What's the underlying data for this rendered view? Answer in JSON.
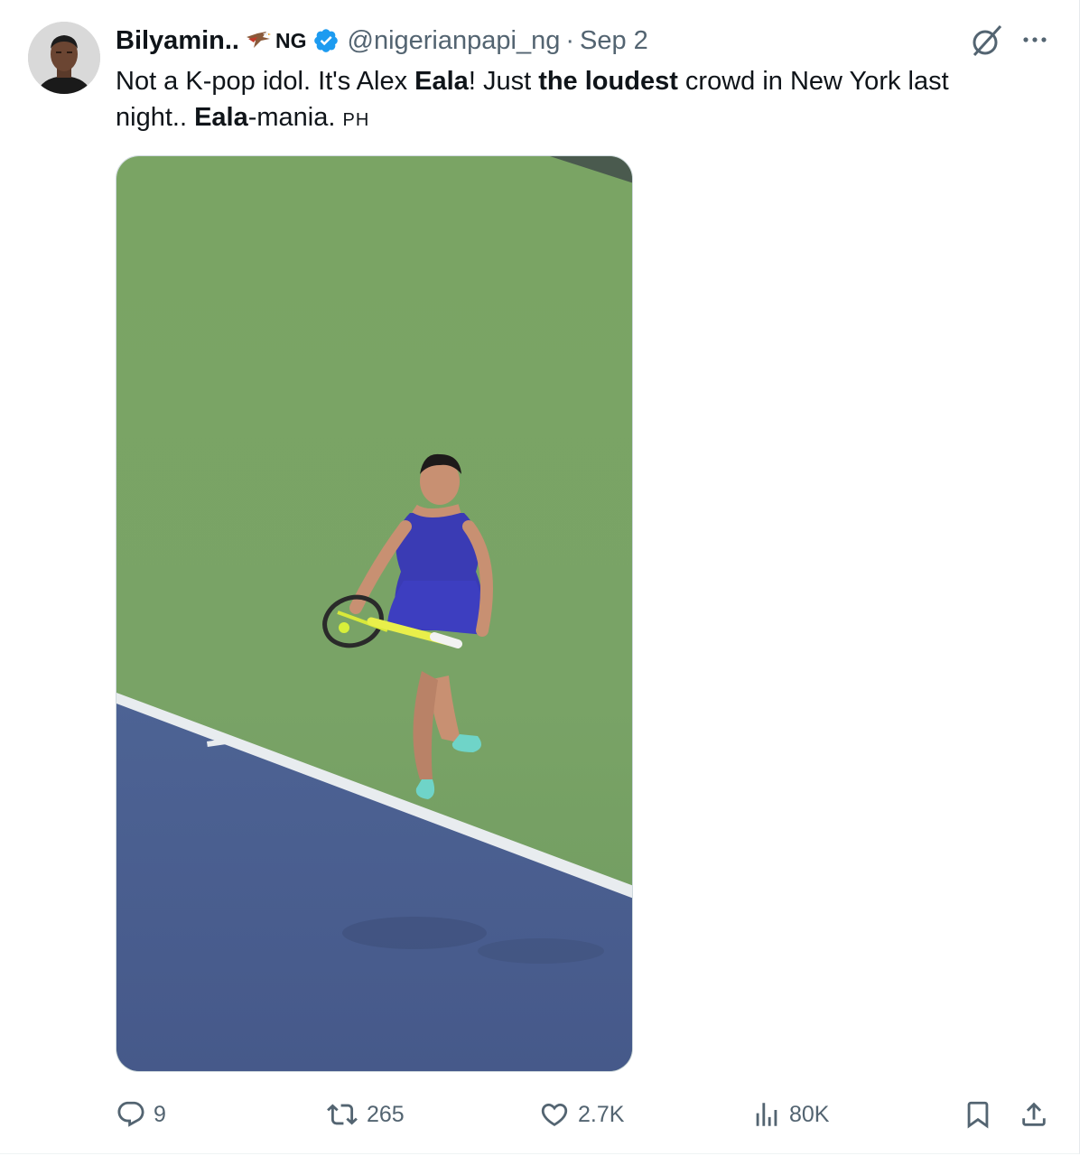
{
  "author": {
    "display_name": "Bilyamin..",
    "flag_text": "NG",
    "handle": "@nigerianpapi_ng",
    "separator": "·",
    "date": "Sep 2"
  },
  "tweet": {
    "text_parts": {
      "p1": "Not a K-pop idol. It's Alex ",
      "b1": "Eala",
      "p2": "!  Just ",
      "b2": "the loudest",
      "p3": " crowd in New York last night.. ",
      "b3": "Eala",
      "p4": "-mania. ",
      "flag_code": "PH"
    }
  },
  "icons": {
    "verified": "verified-badge-icon",
    "grok": "grok-icon",
    "more": "more-icon",
    "reply": "reply-icon",
    "retweet": "retweet-icon",
    "like": "like-icon",
    "views": "views-icon",
    "bookmark": "bookmark-icon",
    "share": "share-icon"
  },
  "actions": {
    "replies": "9",
    "retweets": "265",
    "likes": "2.7K",
    "views": "80K"
  },
  "colors": {
    "accent": "#1d9bf0",
    "secondary_text": "#536471",
    "primary_text": "#0f1419",
    "court_green": "#7ba663",
    "court_blue": "#4a5f8e"
  }
}
